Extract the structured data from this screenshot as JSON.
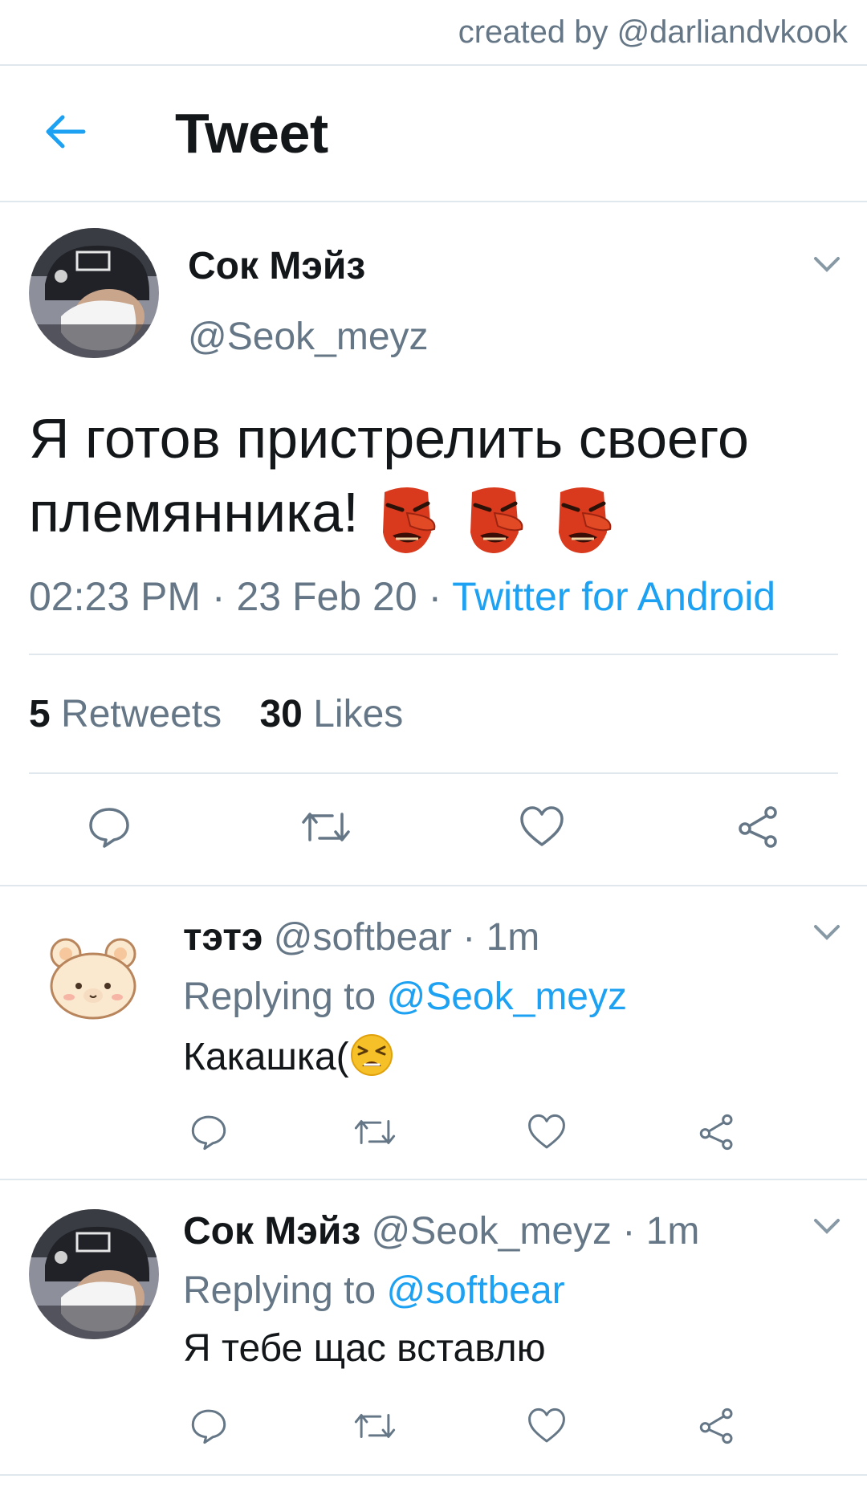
{
  "watermark": "created by @darliandvkook",
  "header": {
    "title": "Tweet"
  },
  "tweet": {
    "name": "Сок Мэйз",
    "handle": "@Seok_meyz",
    "text": "Я готов пристрелить своего племянника!",
    "time": "02:23 PM",
    "date": "23 Feb 20",
    "separator": " · ",
    "source": "Twitter for Android",
    "retweets_count": "5",
    "retweets_label": "Retweets",
    "likes_count": "30",
    "likes_label": "Likes",
    "emojis": [
      "goblin-mask",
      "goblin-mask",
      "goblin-mask"
    ]
  },
  "replies": [
    {
      "name": "тэтэ",
      "handle": "@softbear",
      "dot": " · ",
      "time": "1m",
      "replying_prefix": "Replying to ",
      "replying_to": "@Seok_meyz",
      "text": "Какашка(",
      "emoji": "tired-face"
    },
    {
      "name": "Сок Мэйз",
      "handle": "@Seok_meyz",
      "dot": " · ",
      "time": "1m",
      "replying_prefix": "Replying to ",
      "replying_to": "@softbear",
      "text": "Я тебе щас вставлю"
    }
  ],
  "colors": {
    "accent": "#1da1f2",
    "muted": "#657786",
    "text": "#14171a",
    "divider": "#e1e8ed"
  }
}
